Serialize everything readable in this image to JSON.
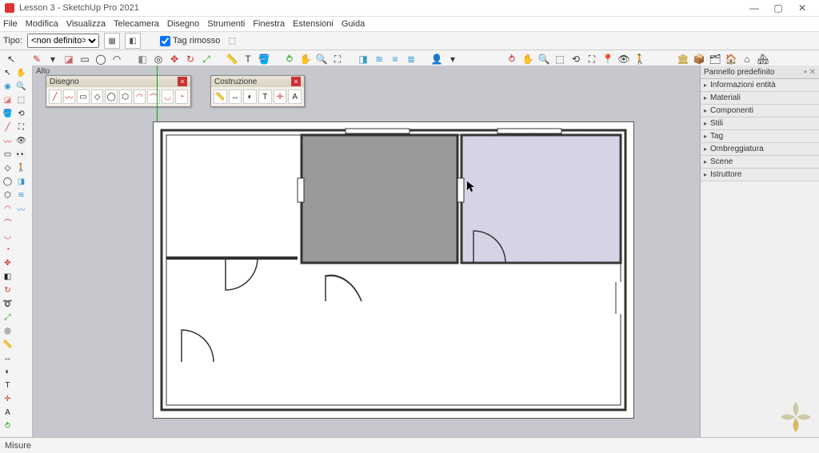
{
  "window": {
    "title": "Lesson 3 - SketchUp Pro 2021"
  },
  "menu": [
    "File",
    "Modifica",
    "Visualizza",
    "Telecamera",
    "Disegno",
    "Strumenti",
    "Finestra",
    "Estensioni",
    "Guida"
  ],
  "opt": {
    "type_label": "Tipo:",
    "type_value": "<non definito>",
    "tag_label": "Tag rimosso"
  },
  "view_label": "Alto",
  "palettes": {
    "disegno": {
      "title": "Disegno"
    },
    "costruzione": {
      "title": "Costruzione"
    }
  },
  "right_panel": {
    "title": "Pannello predefinito",
    "items": [
      "Informazioni entità",
      "Materiali",
      "Componenti",
      "Stili",
      "Tag",
      "Ombreggiatura",
      "Scene",
      "Istruttore"
    ]
  },
  "status": {
    "measure_label": "Misure"
  }
}
